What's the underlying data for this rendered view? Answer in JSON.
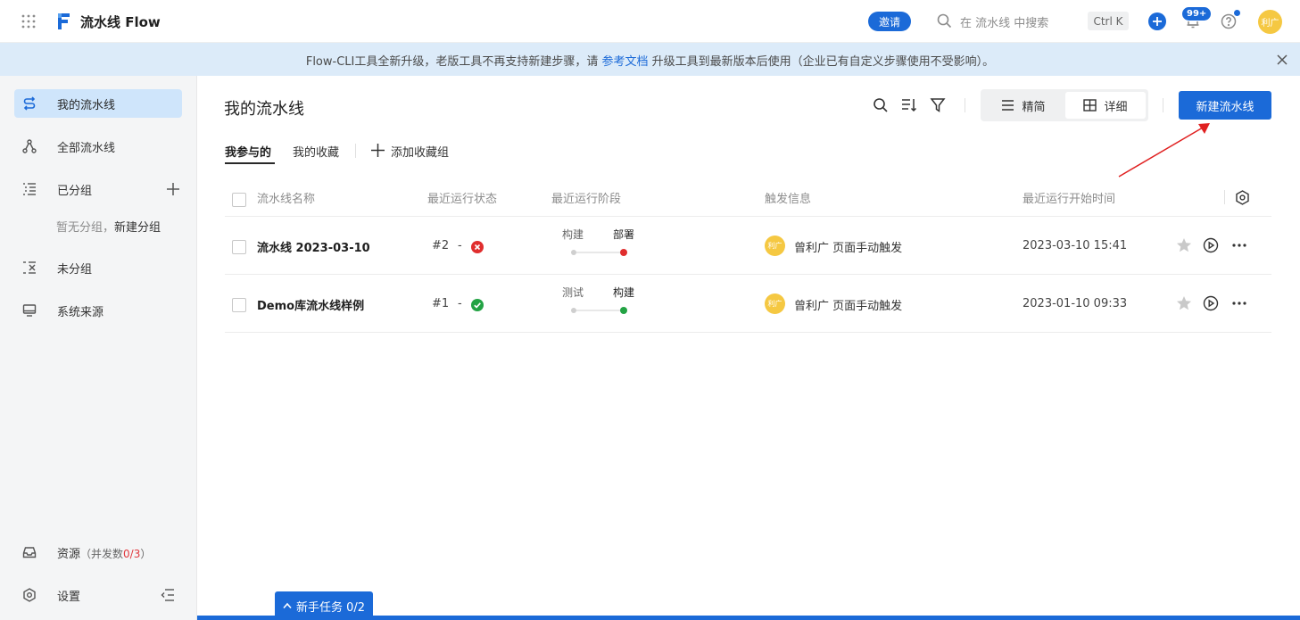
{
  "topbar": {
    "app_title": "流水线 Flow",
    "invite_label": "邀请",
    "search_placeholder": "在 流水线 中搜索",
    "shortcut": "Ctrl K",
    "notifications": "99+",
    "user_avatar": "利广"
  },
  "notice": {
    "text_before": "Flow-CLI工具全新升级，老版工具不再支持新建步骤，请 ",
    "link": "参考文档",
    "text_after": " 升级工具到最新版本后使用（企业已有自定义步骤使用不受影响）。"
  },
  "sidebar": {
    "items": [
      {
        "label": "我的流水线",
        "icon": "pipeline-icon"
      },
      {
        "label": "全部流水线",
        "icon": "nodes-icon"
      },
      {
        "label": "已分组",
        "icon": "list-icon"
      },
      {
        "label": "未分组",
        "icon": "list-x-icon"
      },
      {
        "label": "系统来源",
        "icon": "monitor-icon"
      }
    ],
    "empty_group_text": "暂无分组，",
    "new_group_link": "新建分组",
    "resources_label": "资源",
    "resources_prefix": "（并发数",
    "resources_count": "0/3",
    "resources_suffix": "）",
    "settings_label": "设置"
  },
  "main": {
    "title": "我的流水线",
    "view_simple": "精简",
    "view_detail": "详细",
    "new_button": "新建流水线",
    "tabs": [
      "我参与的",
      "我的收藏"
    ],
    "add_favorite_group": "添加收藏组",
    "columns": [
      "流水线名称",
      "最近运行状态",
      "最近运行阶段",
      "触发信息",
      "最近运行开始时间"
    ],
    "rows": [
      {
        "name": "流水线 2023-03-10",
        "run_number": "#2",
        "dash": "-",
        "status": "failed",
        "status_color": "#e02e2e",
        "stages": [
          "构建",
          "部署"
        ],
        "trigger_avatar": "利广",
        "trigger": "曾利广 页面手动触发",
        "start_time": "2023-03-10 15:41"
      },
      {
        "name": "Demo库流水线样例",
        "run_number": "#1",
        "dash": "-",
        "status": "success",
        "status_color": "#23a344",
        "stages": [
          "测试",
          "构建"
        ],
        "trigger_avatar": "利广",
        "trigger": "曾利广 页面手动触发",
        "start_time": "2023-01-10 09:33"
      }
    ]
  },
  "tasks": {
    "label": "新手任务 0/2"
  },
  "colors": {
    "primary": "#1b6ad8",
    "notice_bg": "#dcebf9",
    "sidebar_bg": "#f4f5f6",
    "active_nav": "#cfe5fb",
    "annotation_arrow": "#e02020"
  }
}
